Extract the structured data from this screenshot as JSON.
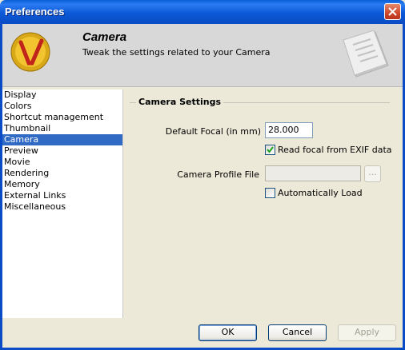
{
  "window": {
    "title": "Preferences"
  },
  "header": {
    "title": "Camera",
    "subtitle": "Tweak the settings related to your Camera"
  },
  "categories": [
    {
      "label": "Display",
      "selected": false
    },
    {
      "label": "Colors",
      "selected": false
    },
    {
      "label": "Shortcut management",
      "selected": false
    },
    {
      "label": "Thumbnail",
      "selected": false
    },
    {
      "label": "Camera",
      "selected": true
    },
    {
      "label": "Preview",
      "selected": false
    },
    {
      "label": "Movie",
      "selected": false
    },
    {
      "label": "Rendering",
      "selected": false
    },
    {
      "label": "Memory",
      "selected": false
    },
    {
      "label": "External Links",
      "selected": false
    },
    {
      "label": "Miscellaneous",
      "selected": false
    }
  ],
  "camera_settings": {
    "section_title": "Camera Settings",
    "default_focal_label": "Default Focal (in mm)",
    "default_focal_value": "28.000",
    "read_exif_label": "Read focal from EXIF data",
    "read_exif_checked": true,
    "profile_file_label": "Camera Profile File",
    "profile_file_value": "",
    "browse_label": "...",
    "auto_load_label": "Automatically Load",
    "auto_load_checked": false
  },
  "buttons": {
    "ok": "OK",
    "cancel": "Cancel",
    "apply": "Apply"
  }
}
